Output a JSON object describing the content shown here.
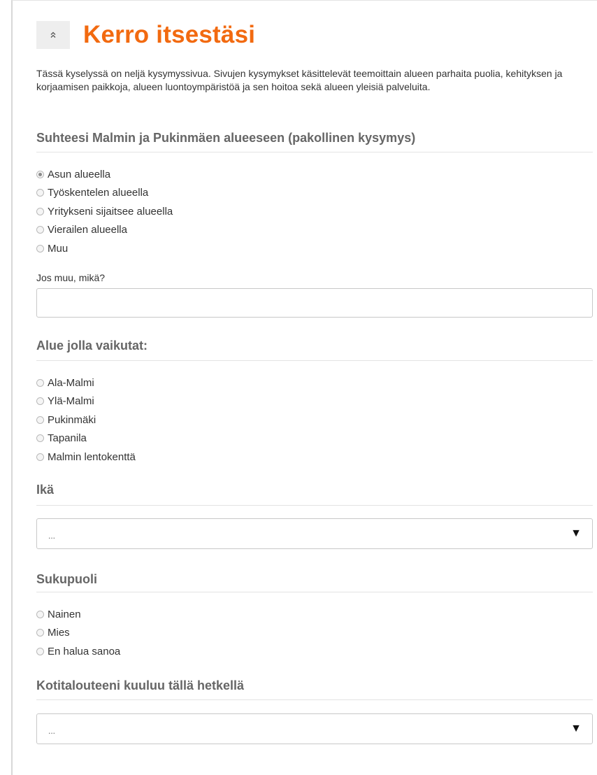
{
  "header": {
    "collapse_icon": "chevron-double-up-icon",
    "title": "Kerro itsestäsi",
    "title_color": "#f26a10"
  },
  "intro": "Tässä kyselyssä on neljä kysymyssivua. Sivujen kysymykset käsittelevät teemoittain alueen parhaita puolia, kehityksen ja korjaamisen paikkoja, alueen luontoympäristöä ja sen hoitoa sekä alueen yleisiä palveluita.",
  "relation": {
    "title": "Suhteesi Malmin ja Pukinmäen alueeseen (pakollinen kysymys)",
    "options": [
      "Asun alueella",
      "Työskentelen alueella",
      "Yritykseni sijaitsee alueella",
      "Vierailen alueella",
      "Muu"
    ],
    "selected": "Asun alueella",
    "other_label": "Jos muu, mikä?",
    "other_value": ""
  },
  "area": {
    "title": "Alue jolla vaikutat:",
    "options": [
      "Ala-Malmi",
      "Ylä-Malmi",
      "Pukinmäki",
      "Tapanila",
      "Malmin lentokenttä"
    ]
  },
  "age": {
    "title": "Ikä",
    "selected": "...",
    "arrow_icon": "triangle-down-icon"
  },
  "gender": {
    "title": "Sukupuoli",
    "options": [
      "Nainen",
      "Mies",
      "En halua sanoa"
    ]
  },
  "household": {
    "title": "Kotitalouteeni kuuluu tällä hetkellä",
    "selected": "...",
    "arrow_icon": "triangle-down-icon"
  }
}
